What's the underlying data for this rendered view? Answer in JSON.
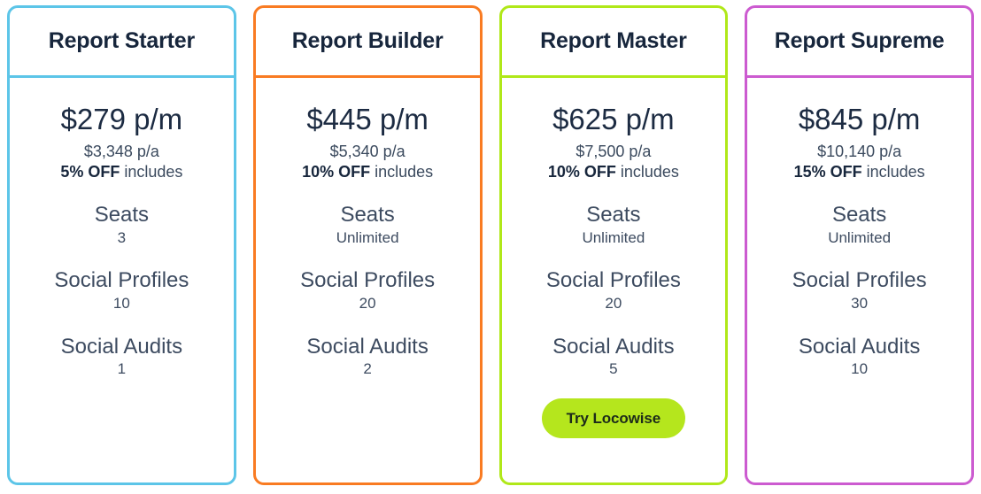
{
  "page": {
    "background": "#ffffff",
    "text_dark": "#17263c",
    "text_muted": "#3d4b60"
  },
  "plans": [
    {
      "id": "report-starter",
      "title": "Report Starter",
      "accent": "#5cc5e8",
      "price_monthly": "$279 p/m",
      "price_annual": "$3,348 p/a",
      "discount": "5% OFF",
      "discount_suffix": " includes",
      "features": [
        {
          "label": "Seats",
          "value": "3"
        },
        {
          "label": "Social Profiles",
          "value": "10"
        },
        {
          "label": "Social Audits",
          "value": "1"
        }
      ],
      "cta": null
    },
    {
      "id": "report-builder",
      "title": "Report Builder",
      "accent": "#f97b22",
      "price_monthly": "$445 p/m",
      "price_annual": "$5,340 p/a",
      "discount": "10% OFF",
      "discount_suffix": " includes",
      "features": [
        {
          "label": "Seats",
          "value": "Unlimited"
        },
        {
          "label": "Social Profiles",
          "value": "20"
        },
        {
          "label": "Social Audits",
          "value": "2"
        }
      ],
      "cta": null
    },
    {
      "id": "report-master",
      "title": "Report Master",
      "accent": "#b0e819",
      "price_monthly": "$625 p/m",
      "price_annual": "$7,500 p/a",
      "discount": "10% OFF",
      "discount_suffix": " includes",
      "features": [
        {
          "label": "Seats",
          "value": "Unlimited"
        },
        {
          "label": "Social Profiles",
          "value": "20"
        },
        {
          "label": "Social Audits",
          "value": "5"
        }
      ],
      "cta": {
        "label": "Try Locowise",
        "background": "#b5e61d",
        "text_color": "#1d2b1a"
      }
    },
    {
      "id": "report-supreme",
      "title": "Report Supreme",
      "accent": "#cc5bd0",
      "price_monthly": "$845 p/m",
      "price_annual": "$10,140 p/a",
      "discount": "15% OFF",
      "discount_suffix": " includes",
      "features": [
        {
          "label": "Seats",
          "value": "Unlimited"
        },
        {
          "label": "Social Profiles",
          "value": "30"
        },
        {
          "label": "Social Audits",
          "value": "10"
        }
      ],
      "cta": null
    }
  ]
}
